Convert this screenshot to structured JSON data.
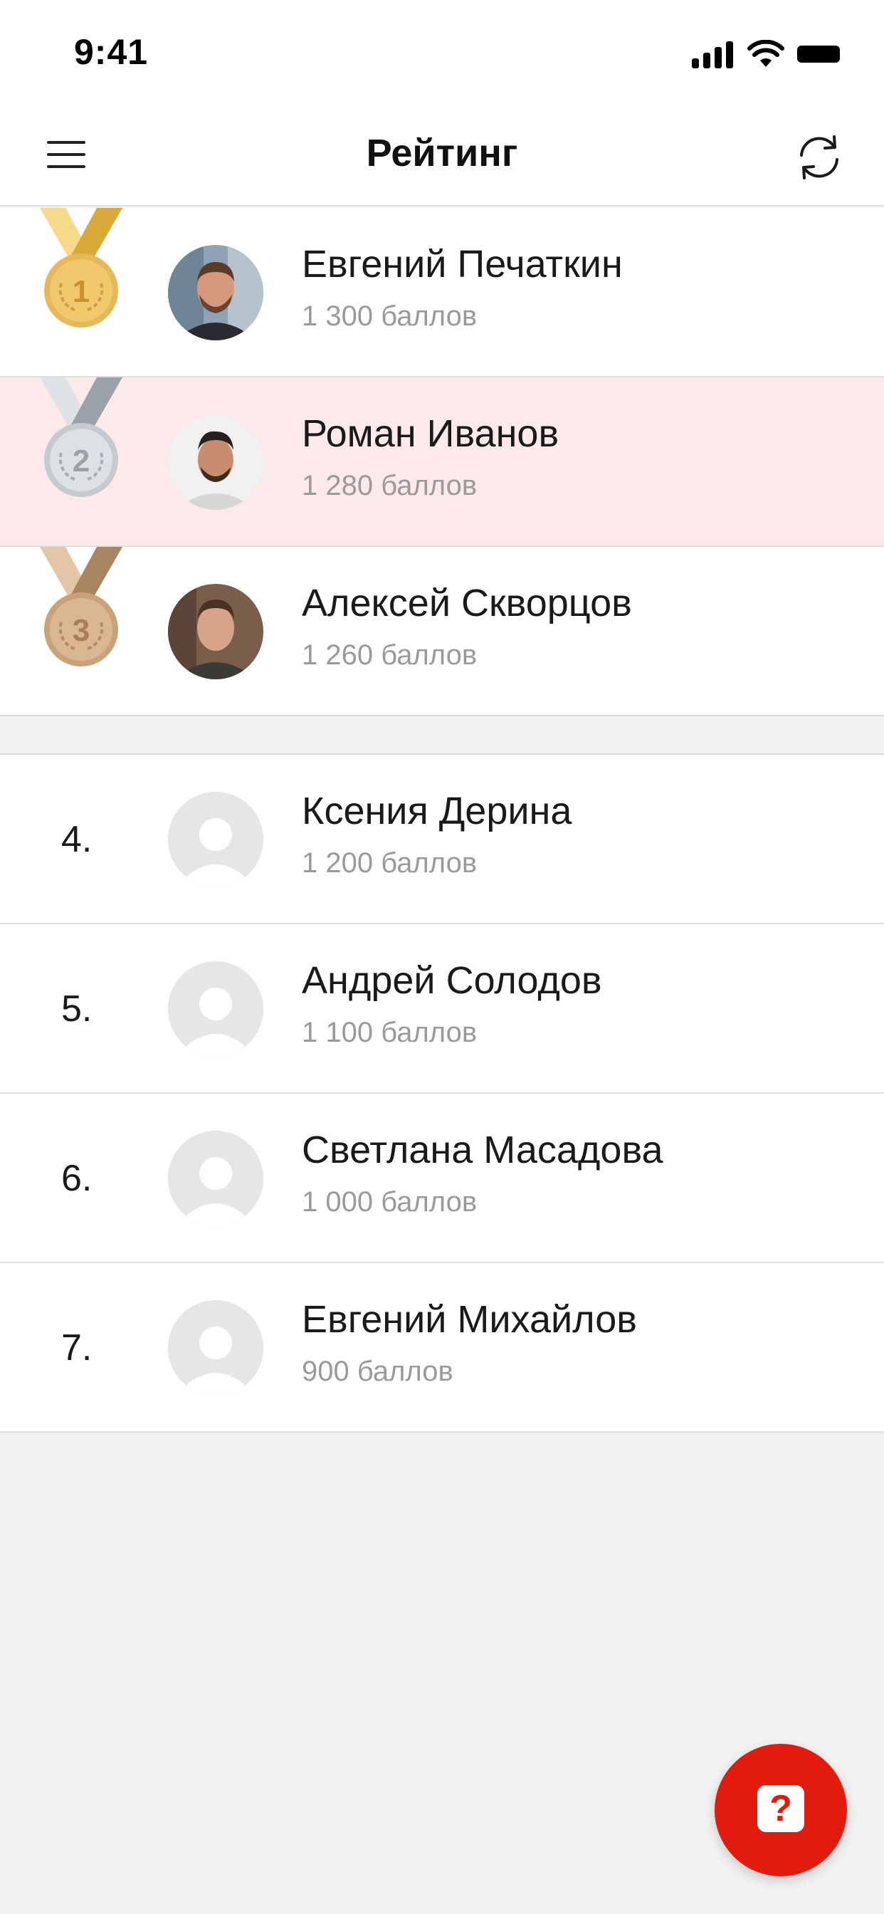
{
  "status_bar": {
    "time": "9:41"
  },
  "header": {
    "title": "Рейтинг"
  },
  "top_ranking": [
    {
      "rank": "1",
      "name": "Евгений Печаткин",
      "score": "1 300 баллов",
      "medal": "gold",
      "highlighted": false
    },
    {
      "rank": "2",
      "name": "Роман Иванов",
      "score": "1 280 баллов",
      "medal": "silver",
      "highlighted": true
    },
    {
      "rank": "3",
      "name": "Алексей Скворцов",
      "score": "1 260 баллов",
      "medal": "bronze",
      "highlighted": false
    }
  ],
  "ranking": [
    {
      "rank": "4.",
      "name": "Ксения Дерина",
      "score": "1 200 баллов"
    },
    {
      "rank": "5.",
      "name": "Андрей Солодов",
      "score": "1 100 баллов"
    },
    {
      "rank": "6.",
      "name": "Светлана Масадова",
      "score": "1 000 баллов"
    },
    {
      "rank": "7.",
      "name": "Евгений Михайлов",
      "score": "900 баллов"
    }
  ],
  "help_button": {
    "label": "?"
  },
  "colors": {
    "accent": "#e31b0c",
    "highlight": "#fce9e9",
    "gold": "#e7b85a",
    "silver": "#c5cace",
    "bronze": "#c9a27a"
  },
  "icons": {
    "menu": "hamburger-menu-icon",
    "refresh": "refresh-icon",
    "help": "help-question-icon",
    "avatar_placeholder": "user-placeholder-icon"
  }
}
